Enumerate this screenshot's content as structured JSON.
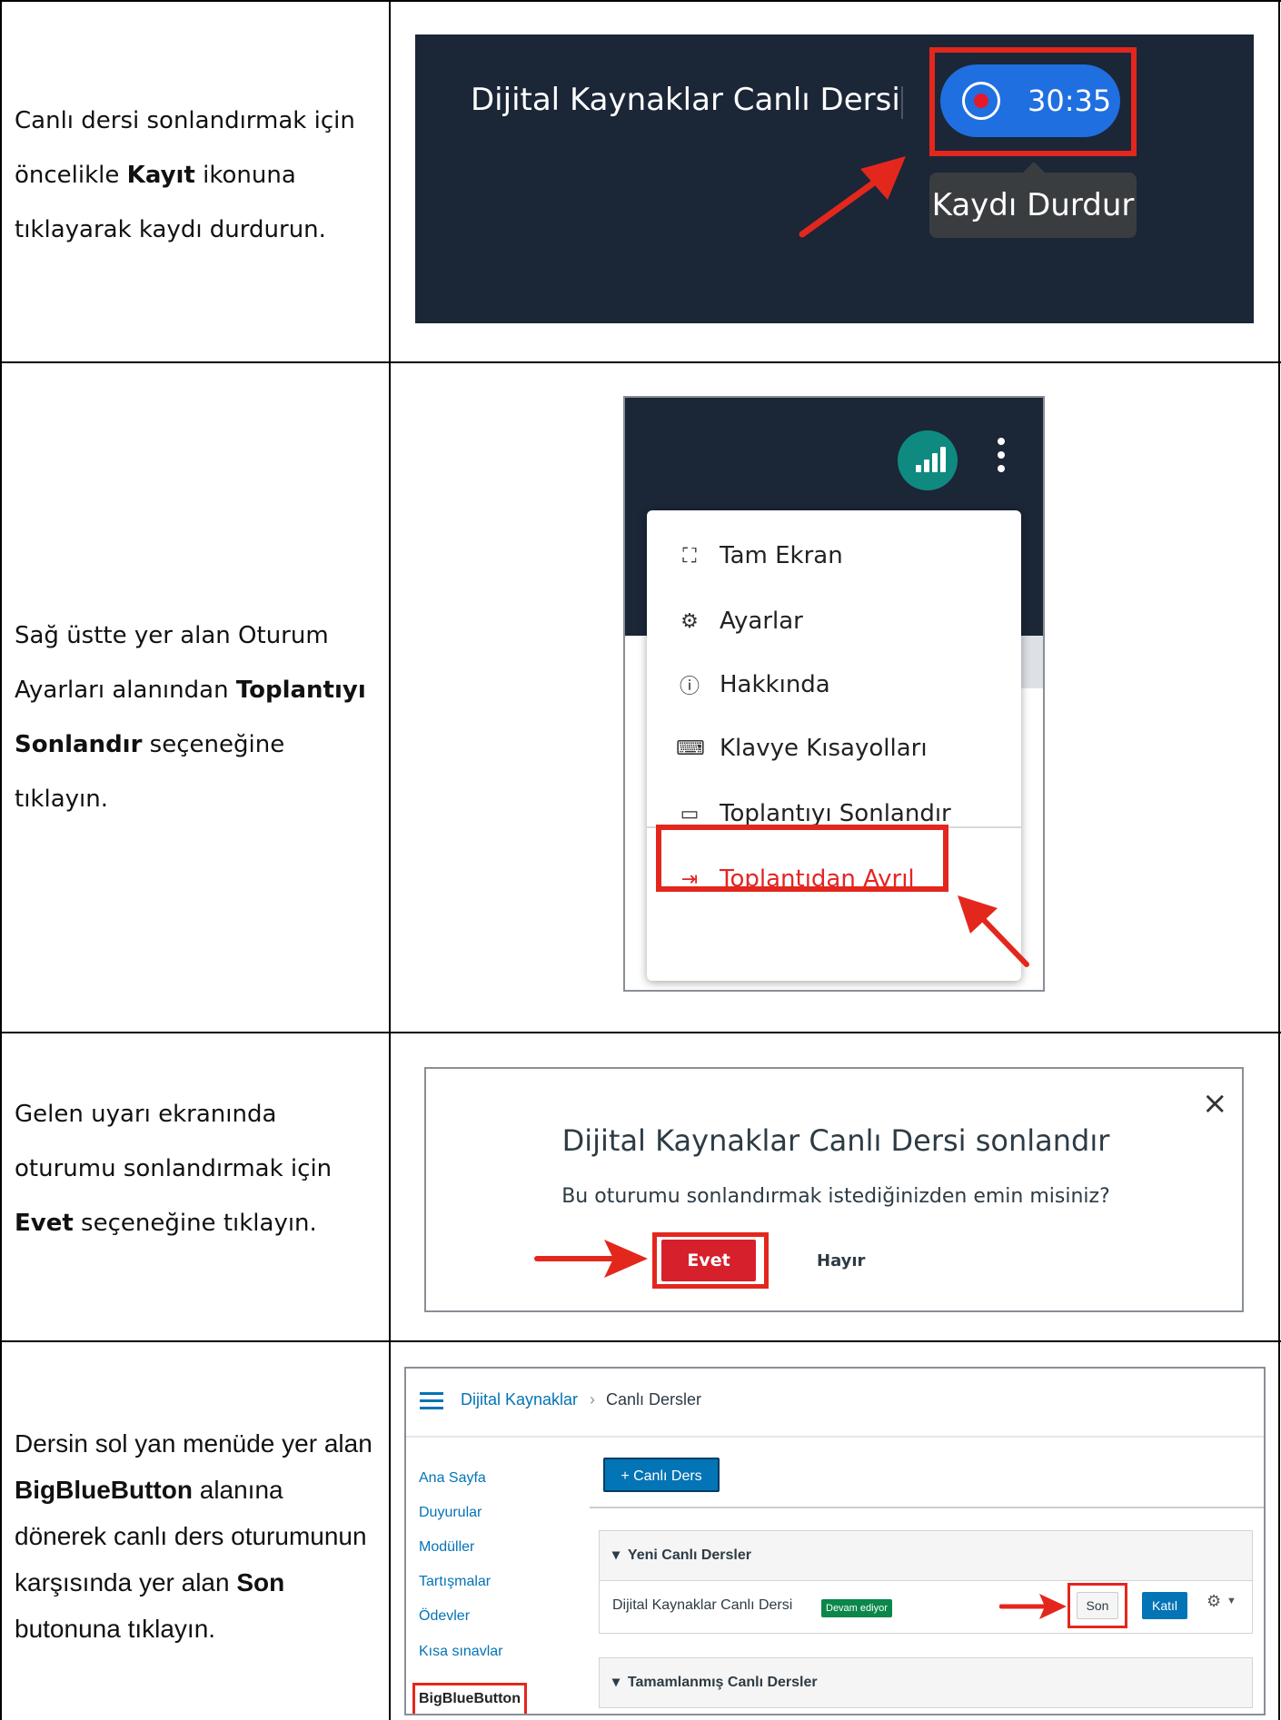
{
  "rows": [
    {
      "instruction_parts": [
        "Canlı dersi sonlandırmak için öncelikle ",
        "Kayıt",
        " ikonuna tıklayarak kaydı durdurun."
      ]
    },
    {
      "instruction_parts": [
        "Sağ üstte yer alan Oturum Ayarları alanından ",
        "Toplantıyı Sonlandır",
        " seçeneğine tıklayın."
      ]
    },
    {
      "instruction_parts": [
        "Gelen uyarı ekranında oturumu sonlandırmak için ",
        "Evet",
        " seçeneğine tıklayın."
      ]
    },
    {
      "instruction_parts": [
        "Dersin sol yan menüde yer alan ",
        "BigBlueButton",
        " alanına dönerek canlı ders oturumunun karşısında yer alan ",
        "Son",
        " butonuna tıklayın."
      ]
    }
  ],
  "recording": {
    "title": "Dijital Kaynaklar Canlı Dersi",
    "time": "30:35",
    "tooltip": "Kaydı Durdur",
    "colors": {
      "bar": "#1b2637",
      "pill": "#1f6fe0",
      "highlight": "#e3271d"
    }
  },
  "menu": {
    "items": [
      {
        "icon": "fullscreen-icon",
        "label": "Tam Ekran"
      },
      {
        "icon": "gear-icon",
        "label": "Ayarlar"
      },
      {
        "icon": "info-icon",
        "label": "Hakkında"
      },
      {
        "icon": "keyboard-icon",
        "label": "Klavye Kısayolları"
      },
      {
        "icon": "window-icon",
        "label": "Toplantıyı Sonlandır"
      },
      {
        "icon": "leave-icon",
        "label": "Toplantıdan Ayrıl"
      }
    ]
  },
  "dialog": {
    "title": "Dijital Kaynaklar Canlı Dersi sonlandır",
    "message": "Bu oturumu sonlandırmak istediğinizden emin misiniz?",
    "yes": "Evet",
    "no": "Hayır",
    "close": "×"
  },
  "lms": {
    "breadcrumb": [
      "Dijital Kaynaklar",
      "Canlı Dersler"
    ],
    "breadcrumb_separator": "›",
    "sidebar": [
      "Ana Sayfa",
      "Duyurular",
      "Modüller",
      "Tartışmalar",
      "Ödevler",
      "Kısa sınavlar",
      "BigBlueButton"
    ],
    "add_button": "+ Canlı Ders",
    "section_new": "Yeni Canlı Dersler",
    "section_done": "Tamamlanmış Canlı Dersler",
    "row_title": "Dijital Kaynaklar Canlı Dersi",
    "status_badge": "Devam ediyor",
    "end_button": "Son",
    "join_button": "Katıl"
  }
}
